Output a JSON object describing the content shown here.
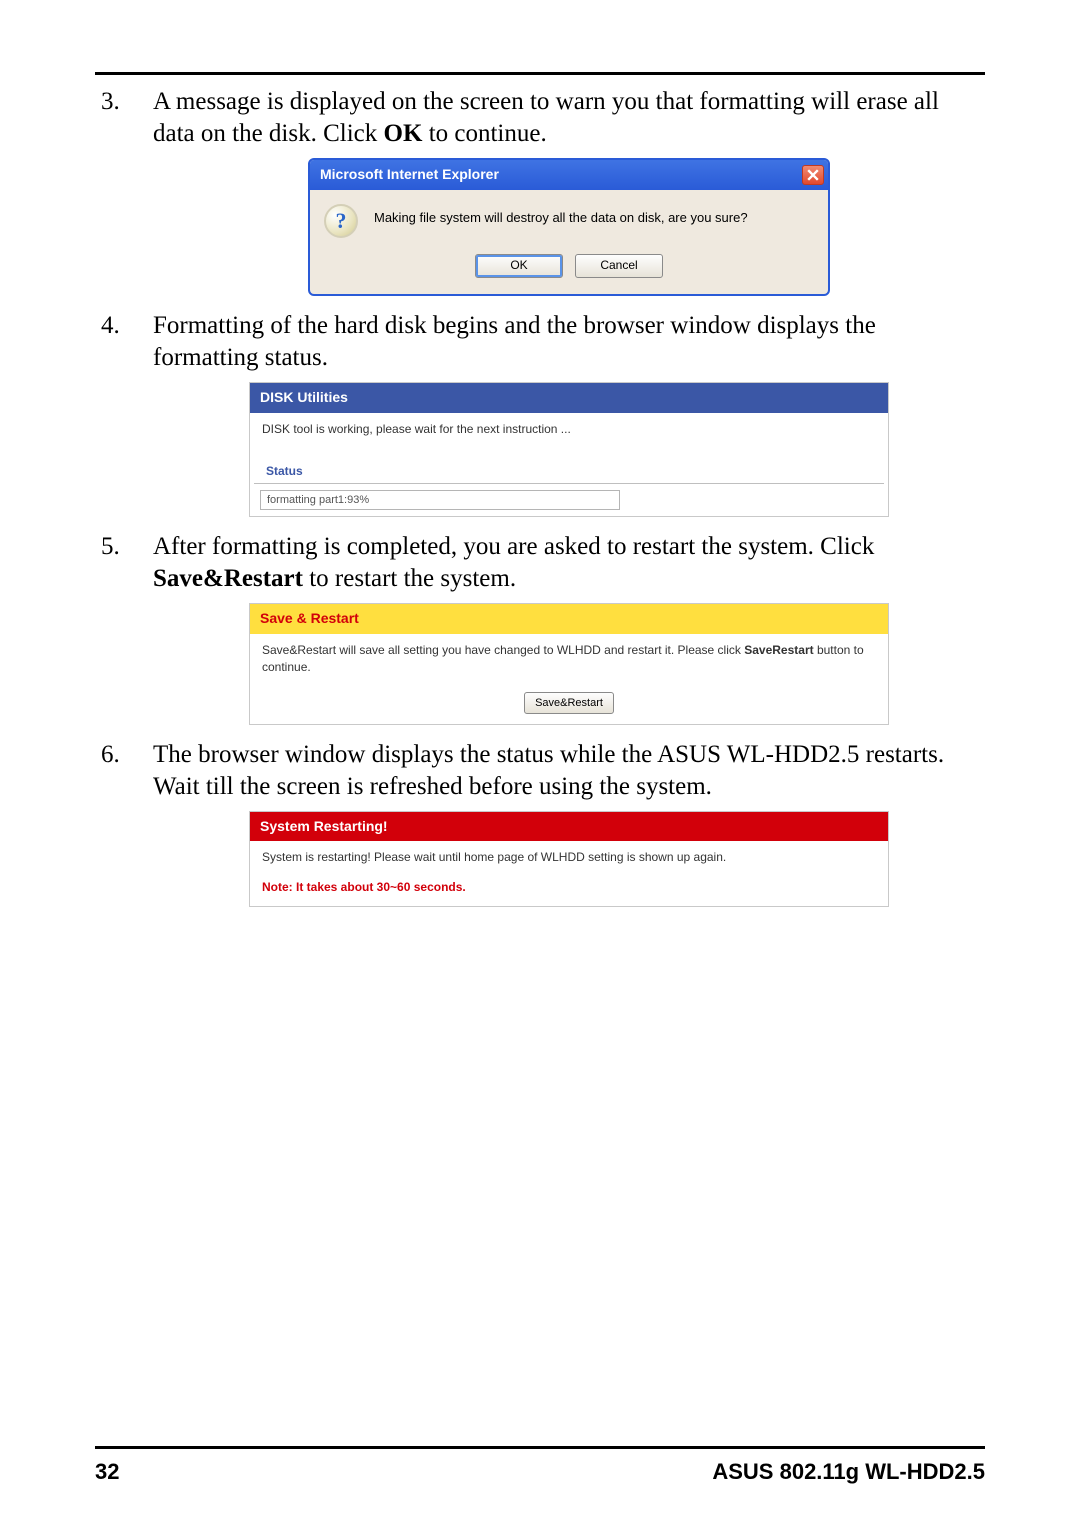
{
  "steps": {
    "s3": {
      "text_pre": "A message is displayed on the screen to warn you that formatting will erase all data on the disk. Click ",
      "bold": "OK",
      "text_post": " to continue."
    },
    "s4": {
      "text": "Formatting of the hard disk begins and the browser window displays the formatting status."
    },
    "s5": {
      "text_pre": "After formatting is completed, you are asked to restart the system. Click ",
      "bold": "Save&Restart",
      "text_post": " to restart the system."
    },
    "s6": {
      "text": "The browser window displays the status while the ASUS WL-HDD2.5 restarts. Wait till the screen is refreshed before using the system."
    }
  },
  "ie_dialog": {
    "title": "Microsoft Internet Explorer",
    "message": "Making file system will destroy all the data on disk, are you sure?",
    "ok": "OK",
    "cancel": "Cancel"
  },
  "disk_util": {
    "header": "DISK Utilities",
    "msg": "DISK tool is working, please wait for the next instruction ...",
    "status_label": "Status",
    "status_value": "formatting part1:93%"
  },
  "save_restart": {
    "header": "Save & Restart",
    "msg_pre": "Save&Restart will save all setting you have changed to WLHDD and restart it. Please click ",
    "msg_bold": "SaveRestart",
    "msg_post": " button to continue.",
    "button": "Save&Restart"
  },
  "restarting": {
    "header": "System Restarting!",
    "msg": "System is restarting! Please wait until home page of WLHDD setting is shown up again.",
    "note": "Note: It takes about 30~60 seconds."
  },
  "footer": {
    "page": "32",
    "title": "ASUS 802.11g WL-HDD2.5"
  }
}
